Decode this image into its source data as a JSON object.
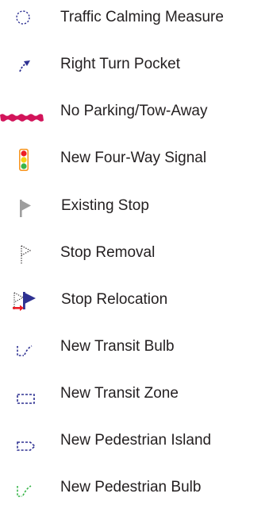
{
  "legend": {
    "items": [
      {
        "label": "Traffic Calming Measure",
        "icon": "dashed-circle-icon",
        "color": "#2e3192"
      },
      {
        "label": "Right Turn Pocket",
        "icon": "right-turn-arrow-icon",
        "color": "#2e3192"
      },
      {
        "label": "No Parking/Tow-Away",
        "icon": "red-wavy-bar-icon",
        "color": "#d2145a"
      },
      {
        "label": "New Four-Way Signal",
        "icon": "traffic-signal-icon",
        "colors": {
          "red": "#ed1c24",
          "yellow": "#f7d117",
          "green": "#39b54a",
          "housing": "#f7941d"
        }
      },
      {
        "label": "Existing Stop",
        "icon": "gray-flag-icon",
        "color": "#9e9e9e"
      },
      {
        "label": "Stop Removal",
        "icon": "dotted-flag-icon",
        "color": "#231f20"
      },
      {
        "label": "Stop Relocation",
        "icon": "flag-relocation-icon",
        "colors": {
          "flag": "#2e3192",
          "arrow": "#ed1c24",
          "ghost": "#231f20"
        }
      },
      {
        "label": "New Transit Bulb",
        "icon": "transit-bulb-icon",
        "color": "#2e3192"
      },
      {
        "label": "New Transit Zone",
        "icon": "transit-zone-icon",
        "color": "#2e3192"
      },
      {
        "label": "New Pedestrian Island",
        "icon": "pedestrian-island-icon",
        "color": "#2e3192"
      },
      {
        "label": "New Pedestrian Bulb",
        "icon": "pedestrian-bulb-icon",
        "color": "#39b54a"
      }
    ]
  }
}
